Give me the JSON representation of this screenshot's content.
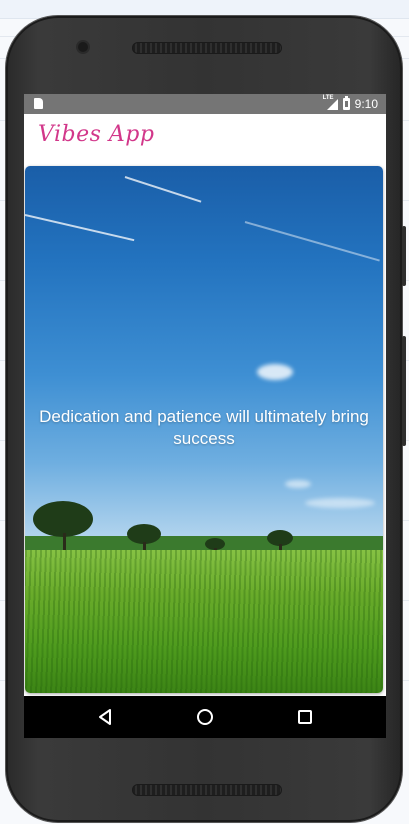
{
  "status_bar": {
    "network": "LTE",
    "time": "9:10"
  },
  "app": {
    "title": "Vibes App",
    "title_color": "#d2378a"
  },
  "card": {
    "quote": "Dedication and patience will ultimately bring success",
    "background": "sky-over-green-field"
  },
  "nav_bar": {
    "back": "back-icon",
    "home": "home-icon",
    "recents": "recents-icon"
  },
  "colors": {
    "status_bar": "#757575",
    "nav_bar": "#000000",
    "quote_text": "#ffffff"
  }
}
